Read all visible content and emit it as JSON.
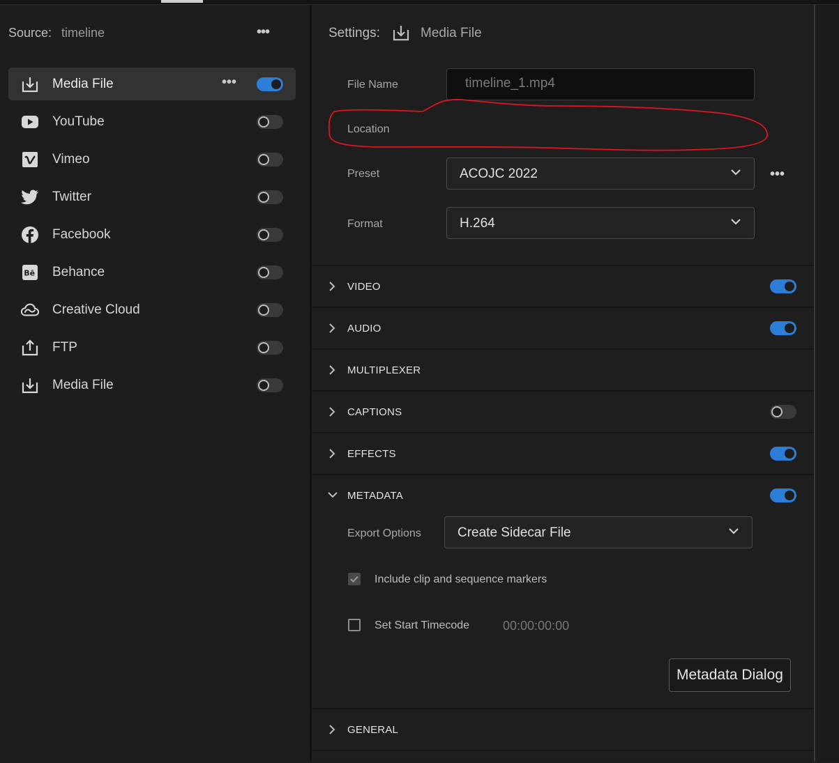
{
  "source": {
    "label": "Source:",
    "value": "timeline"
  },
  "destinations": [
    {
      "label": "Media File",
      "icon": "download-icon",
      "enabled": true,
      "selected": true
    },
    {
      "label": "YouTube",
      "icon": "youtube-icon",
      "enabled": false
    },
    {
      "label": "Vimeo",
      "icon": "vimeo-icon",
      "enabled": false
    },
    {
      "label": "Twitter",
      "icon": "twitter-icon",
      "enabled": false
    },
    {
      "label": "Facebook",
      "icon": "facebook-icon",
      "enabled": false
    },
    {
      "label": "Behance",
      "icon": "behance-icon",
      "enabled": false
    },
    {
      "label": "Creative Cloud",
      "icon": "creative-cloud-icon",
      "enabled": false
    },
    {
      "label": "FTP",
      "icon": "upload-icon",
      "enabled": false
    },
    {
      "label": "Media File",
      "icon": "download-icon",
      "enabled": false
    }
  ],
  "settings": {
    "label": "Settings:",
    "value": "Media File",
    "file_name_label": "File Name",
    "file_name_value": "timeline_1.mp4",
    "location_label": "Location",
    "preset_label": "Preset",
    "preset_value": "ACOJC 2022",
    "format_label": "Format",
    "format_value": "H.264"
  },
  "sections": [
    {
      "title": "VIDEO",
      "expanded": false,
      "toggle": true
    },
    {
      "title": "AUDIO",
      "expanded": false,
      "toggle": true
    },
    {
      "title": "MULTIPLEXER",
      "expanded": false,
      "toggle": null
    },
    {
      "title": "CAPTIONS",
      "expanded": false,
      "toggle": false
    },
    {
      "title": "EFFECTS",
      "expanded": false,
      "toggle": true
    },
    {
      "title": "METADATA",
      "expanded": true,
      "toggle": true
    },
    {
      "title": "GENERAL",
      "expanded": false,
      "toggle": null
    }
  ],
  "metadata": {
    "export_options_label": "Export Options",
    "export_options_value": "Create Sidecar File",
    "include_markers_label": "Include clip and sequence markers",
    "include_markers_checked": true,
    "set_start_timecode_label": "Set Start Timecode",
    "set_start_timecode_checked": false,
    "timecode_value": "00:00:00:00",
    "metadata_dialog_button": "Metadata Dialog"
  },
  "colors": {
    "accent": "#2d7ed8",
    "annotation": "#e0141e",
    "panel": "#1e1e1e"
  }
}
